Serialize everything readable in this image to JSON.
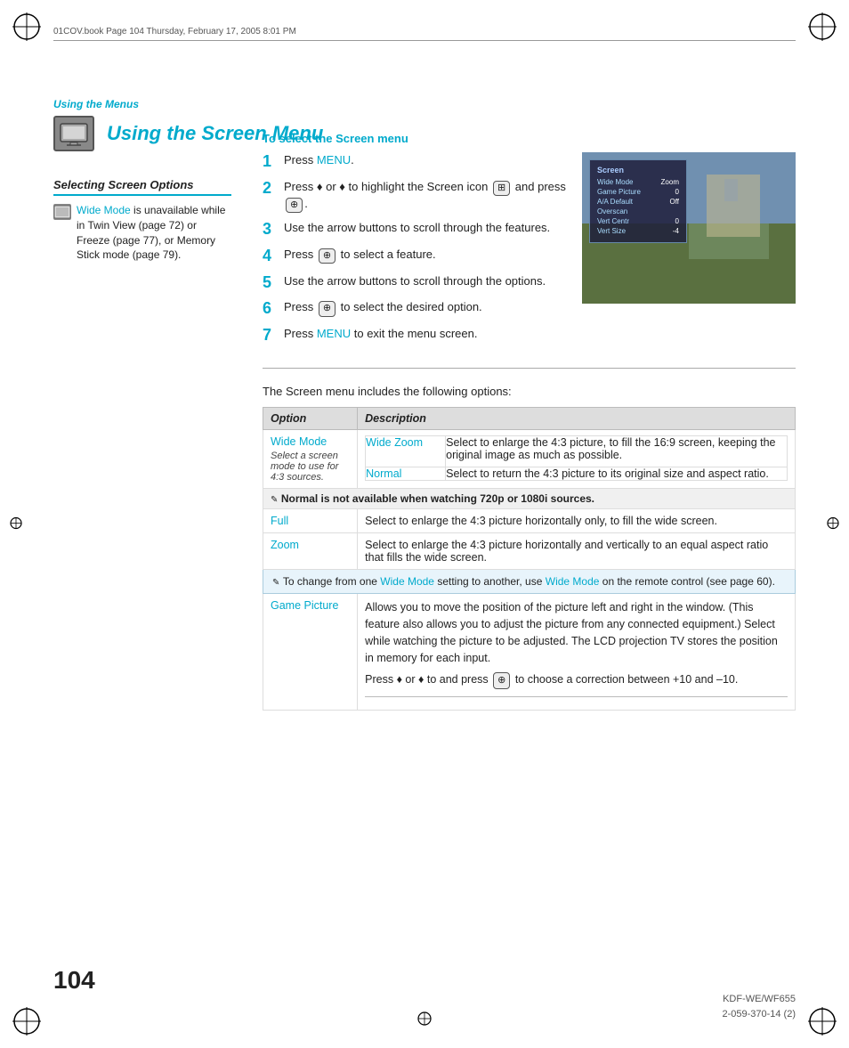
{
  "meta": {
    "file_info": "01COV.book  Page 104  Thursday, February 17, 2005  8:01 PM"
  },
  "breadcrumb": "Using the Menus",
  "page_title": "Using the Screen Menu",
  "section_heading": "To select the Screen menu",
  "steps": [
    {
      "number": "1",
      "text_parts": [
        "Press ",
        "MENU",
        "."
      ]
    },
    {
      "number": "2",
      "text_parts": [
        "Press ♦ or ♦ to highlight the Screen icon ",
        "",
        " and press ",
        "⊕",
        "."
      ]
    },
    {
      "number": "3",
      "text_parts": [
        "Use the arrow buttons to scroll through the features."
      ]
    },
    {
      "number": "4",
      "text_parts": [
        "Press ",
        "⊕",
        " to select a feature."
      ]
    },
    {
      "number": "5",
      "text_parts": [
        "Use the arrow buttons to scroll through the options."
      ]
    },
    {
      "number": "6",
      "text_parts": [
        "Press ",
        "⊕",
        " to select the desired option."
      ]
    },
    {
      "number": "7",
      "text_parts": [
        "Press ",
        "MENU",
        " to exit the menu screen."
      ]
    }
  ],
  "sidebar": {
    "section_title": "Selecting Screen Options",
    "icon_alt": "screen-icon",
    "description_parts": [
      "Wide Mode",
      " is unavailable while in Twin View (page 72) or Freeze (page 77), or Memory Stick mode (page 79)."
    ]
  },
  "intro_para": "The Screen menu includes the following options:",
  "table": {
    "header": [
      "Option",
      "Description"
    ],
    "rows": [
      {
        "option": "Wide Mode",
        "option_sub": "Select a screen mode to use for 4:3 sources.",
        "description": "",
        "sub_rows": [
          {
            "sub_option": "Wide Zoom",
            "desc": "Select to enlarge the 4:3 picture, to fill the 16:9 screen, keeping the original image as much as possible."
          },
          {
            "sub_option": "Normal",
            "desc": "Select to return the 4:3 picture to its original size and aspect ratio."
          }
        ]
      }
    ],
    "normal_note": "Normal is not available when watching 720p or 1080i sources.",
    "full_row": {
      "option": "Full",
      "desc": "Select to enlarge the 4:3 picture horizontally only, to fill the wide screen."
    },
    "zoom_row": {
      "option": "Zoom",
      "desc": "Select to enlarge the 4:3 picture horizontally and vertically to an equal aspect ratio that fills the wide screen."
    },
    "wide_mode_note_parts": [
      "To change from one ",
      "Wide Mode",
      " setting to another, use ",
      "Wide Mode",
      " on the remote control (see page 60)."
    ],
    "game_picture": {
      "option": "Game Picture",
      "desc1": "Allows you to move the position of the picture left and right in the window. (This feature also allows you to adjust the picture from any connected equipment.) Select while watching the picture to be adjusted. The LCD projection TV stores the position in memory for each input.",
      "desc2_parts": [
        "Press ♦ or ♦ to and press ",
        "⊕",
        " to choose a correction between +10 and –10."
      ]
    }
  },
  "screen_menu": {
    "title": "Screen",
    "rows": [
      {
        "label": "Wide Mode",
        "value": "Zoom",
        "selected": false
      },
      {
        "label": "Game Picture",
        "value": "0",
        "selected": false
      },
      {
        "label": "A/A Default",
        "value": "Off",
        "selected": false
      },
      {
        "label": "Overscan",
        "value": "",
        "selected": false
      },
      {
        "label": "Vert Centr",
        "value": "0",
        "selected": false
      },
      {
        "label": "Vert Size",
        "value": "-4",
        "selected": false
      }
    ]
  },
  "page_number": "104",
  "footer": {
    "model": "KDF-WE/WF655",
    "part": "2-059-370-14 (2)"
  }
}
